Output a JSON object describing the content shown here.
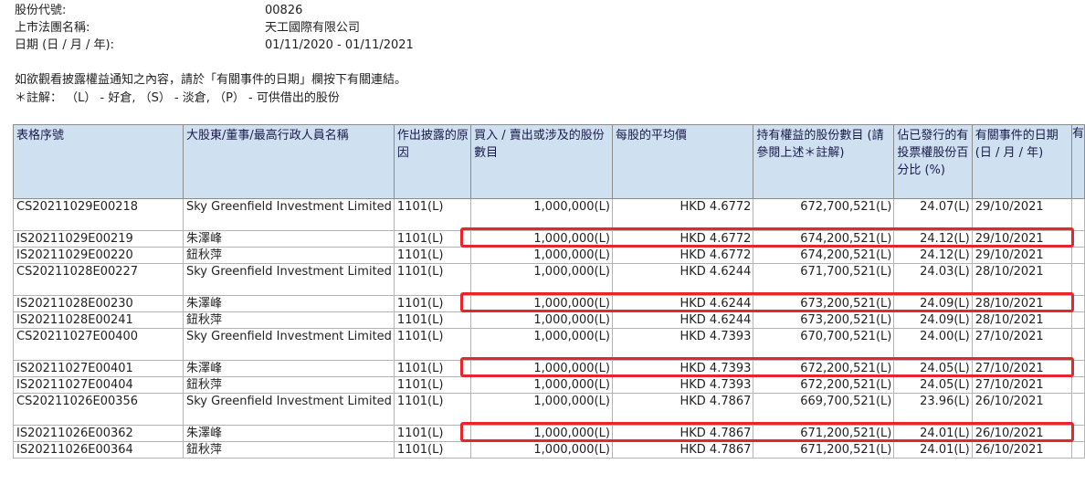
{
  "info": {
    "code_label": "股份代號:",
    "code_value": "00826",
    "company_label": "上市法團名稱:",
    "company_value": "天工國際有限公司",
    "date_label": "日期 (日 / 月 / 年):",
    "date_value": "01/11/2020 - 01/11/2021"
  },
  "notes": {
    "line1": "如欲觀看披露權益通知之內容，請於「有關事件的日期」欄按下有關連結。",
    "line2": "＊註解： （L） - 好倉, （S） - 淡倉, （P） - 可供借出的股份"
  },
  "table": {
    "headers": [
      "表格序號",
      "大股東/董事/最高行政人員名稱",
      "作出披露的原因",
      "買入 / 賣出或涉及的股份數目",
      "每股的平均價",
      "持有權益的股份數目 (請參閱上述＊註解)",
      "佔已發行的有投票權股份百分比 (%)",
      "有關事件的日期 (日 / 月 / 年)",
      "有"
    ],
    "rows": [
      {
        "form": "CS20211029E00218",
        "name": "Sky Greenfield Investment Limited",
        "reason": "1101(L)",
        "shares": "1,000,000(L)",
        "price": "HKD 4.6772",
        "held": "672,700,521(L)",
        "pct": "24.07(L)",
        "date": "29/10/2021"
      },
      {
        "form": "IS20211029E00219",
        "name": "朱澤峰",
        "reason": "1101(L)",
        "shares": "1,000,000(L)",
        "price": "HKD 4.6772",
        "held": "674,200,521(L)",
        "pct": "24.12(L)",
        "date": "29/10/2021"
      },
      {
        "form": "IS20211029E00220",
        "name": "鈕秋萍",
        "reason": "1101(L)",
        "shares": "1,000,000(L)",
        "price": "HKD 4.6772",
        "held": "674,200,521(L)",
        "pct": "24.12(L)",
        "date": "29/10/2021"
      },
      {
        "form": "CS20211028E00227",
        "name": "Sky Greenfield Investment Limited",
        "reason": "1101(L)",
        "shares": "1,000,000(L)",
        "price": "HKD 4.6244",
        "held": "671,700,521(L)",
        "pct": "24.03(L)",
        "date": "28/10/2021"
      },
      {
        "form": "IS20211028E00230",
        "name": "朱澤峰",
        "reason": "1101(L)",
        "shares": "1,000,000(L)",
        "price": "HKD 4.6244",
        "held": "673,200,521(L)",
        "pct": "24.09(L)",
        "date": "28/10/2021"
      },
      {
        "form": "IS20211028E00241",
        "name": "鈕秋萍",
        "reason": "1101(L)",
        "shares": "1,000,000(L)",
        "price": "HKD 4.6244",
        "held": "673,200,521(L)",
        "pct": "24.09(L)",
        "date": "28/10/2021"
      },
      {
        "form": "CS20211027E00400",
        "name": "Sky Greenfield Investment Limited",
        "reason": "1101(L)",
        "shares": "1,000,000(L)",
        "price": "HKD 4.7393",
        "held": "670,700,521(L)",
        "pct": "24.00(L)",
        "date": "27/10/2021"
      },
      {
        "form": "IS20211027E00401",
        "name": "朱澤峰",
        "reason": "1101(L)",
        "shares": "1,000,000(L)",
        "price": "HKD 4.7393",
        "held": "672,200,521(L)",
        "pct": "24.05(L)",
        "date": "27/10/2021"
      },
      {
        "form": "IS20211027E00404",
        "name": "鈕秋萍",
        "reason": "1101(L)",
        "shares": "1,000,000(L)",
        "price": "HKD 4.7393",
        "held": "672,200,521(L)",
        "pct": "24.05(L)",
        "date": "27/10/2021"
      },
      {
        "form": "CS20211026E00356",
        "name": "Sky Greenfield Investment Limited",
        "reason": "1101(L)",
        "shares": "1,000,000(L)",
        "price": "HKD 4.7867",
        "held": "669,700,521(L)",
        "pct": "23.96(L)",
        "date": "26/10/2021"
      },
      {
        "form": "IS20211026E00362",
        "name": "朱澤峰",
        "reason": "1101(L)",
        "shares": "1,000,000(L)",
        "price": "HKD 4.7867",
        "held": "671,200,521(L)",
        "pct": "24.01(L)",
        "date": "26/10/2021"
      },
      {
        "form": "IS20211026E00364",
        "name": "鈕秋萍",
        "reason": "1101(L)",
        "shares": "1,000,000(L)",
        "price": "HKD 4.7867",
        "held": "671,200,521(L)",
        "pct": "24.01(L)",
        "date": "26/10/2021"
      }
    ]
  },
  "highlight_color": "#e8252a",
  "header_bg": "#cfe0f1"
}
